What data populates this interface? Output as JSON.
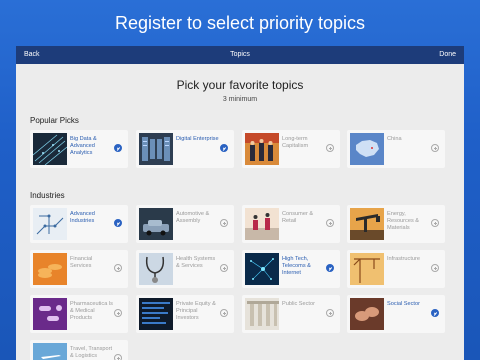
{
  "banner": {
    "title": "Register to select priority topics"
  },
  "nav": {
    "back": "Back",
    "title": "Topics",
    "done": "Done"
  },
  "header": {
    "title": "Pick your favorite topics",
    "subtitle": "3 minimum"
  },
  "sections": {
    "popular": "Popular Picks",
    "industries": "Industries"
  },
  "popular": [
    {
      "label": "Big Data & Advanced Analytics",
      "selected": true,
      "icon": "data-grid-image"
    },
    {
      "label": "Digital Enterprise",
      "selected": true,
      "icon": "server-room-image"
    },
    {
      "label": "Long-term Capitalism",
      "selected": false,
      "icon": "people-in-suits-image"
    },
    {
      "label": "China",
      "selected": false,
      "icon": "china-map-image"
    }
  ],
  "industries": [
    {
      "label": "Advanced Industries",
      "selected": true,
      "icon": "circuit-image"
    },
    {
      "label": "Automotive & Assembly",
      "selected": false,
      "icon": "car-assembly-image"
    },
    {
      "label": "Consumer & Retail",
      "selected": false,
      "icon": "shoppers-image"
    },
    {
      "label": "Energy, Resources & Materials",
      "selected": false,
      "icon": "oil-pump-image"
    },
    {
      "label": "Financial Services",
      "selected": false,
      "icon": "coins-image"
    },
    {
      "label": "Health Systems & Services",
      "selected": false,
      "icon": "stethoscope-image"
    },
    {
      "label": "High Tech, Telecoms & Internet",
      "selected": true,
      "icon": "network-image"
    },
    {
      "label": "Infrastructure",
      "selected": false,
      "icon": "crane-image"
    },
    {
      "label": "Pharmaceutica ls & Medical Products",
      "selected": false,
      "icon": "pills-image"
    },
    {
      "label": "Private Equity & Principal Investors",
      "selected": false,
      "icon": "stock-screen-image"
    },
    {
      "label": "Public Sector",
      "selected": false,
      "icon": "columns-image"
    },
    {
      "label": "Social Sector",
      "selected": true,
      "icon": "hands-image"
    },
    {
      "label": "Travel, Transport & Logistics",
      "selected": false,
      "icon": "airport-image"
    }
  ]
}
